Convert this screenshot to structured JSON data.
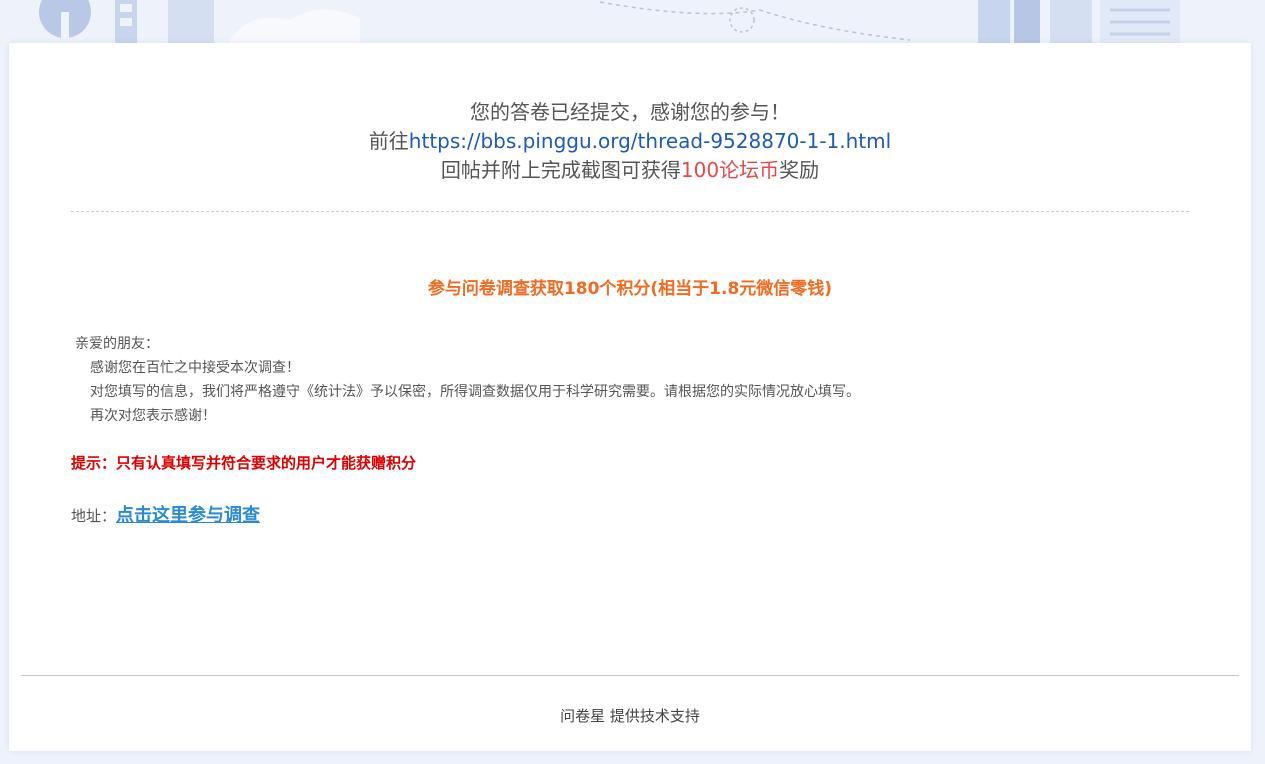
{
  "header": {
    "line1": "您的答卷已经提交，感谢您的参与！",
    "line2_prefix": "前往",
    "link": "https://bbs.pinggu.org/thread-9528870-1-1.html",
    "line3_prefix": "回帖并附上完成截图可获得",
    "reward": "100论坛币",
    "line3_suffix": "奖励"
  },
  "promo": {
    "title": "参与问卷调查获取180个积分(相当于1.8元微信零钱)"
  },
  "letter": {
    "greeting": "亲爱的朋友：",
    "lines": [
      "感谢您在百忙之中接受本次调查！",
      "对您填写的信息，我们将严格遵守《统计法》予以保密，所得调查数据仅用于科学研究需要。请根据您的实际情况放心填写。",
      "再次对您表示感谢！"
    ]
  },
  "tip": {
    "text": "提示：只有认真填写并符合要求的用户才能获赠积分"
  },
  "address": {
    "label": "地址：",
    "link_text": "点击这里参与调查"
  },
  "footer": {
    "text": "问卷星 提供技术支持"
  },
  "colors": {
    "link": "#1e5bb8",
    "reward": "#e8484a",
    "promo": "#f26b21",
    "tip": "#e00000",
    "address_link": "#2a8ad4"
  }
}
